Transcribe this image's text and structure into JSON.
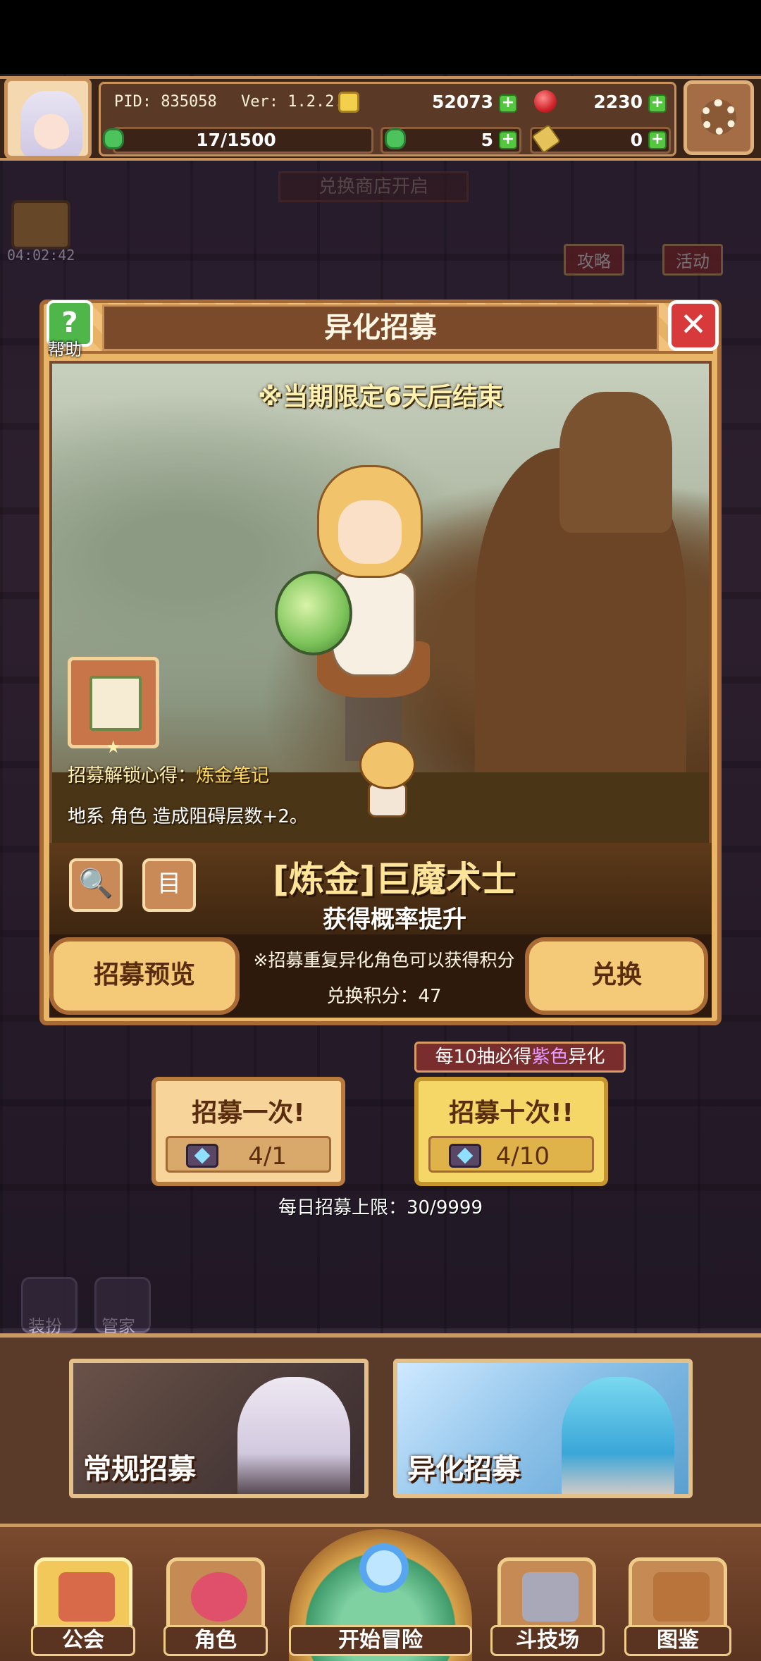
{
  "hud": {
    "pid": "PID: 835058",
    "version": "Ver: 1.2.2.5",
    "stamina": "17/1500",
    "gold": "52073",
    "ruby": "2230",
    "clover": "5",
    "keys": "0",
    "plus": "+"
  },
  "side": {
    "timer": "04:02:42",
    "strategy": "攻略",
    "activity": "活动",
    "exchange_banner": "兑换商店开启",
    "dress": "装扮",
    "steward": "管家"
  },
  "dialog": {
    "title": "异化招募",
    "help_label": "帮助",
    "help_glyph": "?",
    "close_glyph": "✕",
    "limit_notice": "※当期限定6天后结束",
    "unlock_label": "招募解锁心得：",
    "unlock_value": "炼金笔记",
    "effect": "地系 角色 造成阻碍层数+2。",
    "character_name": "[炼金]巨魔术士",
    "rate_up": "获得概率提升",
    "preview_button": "招募预览",
    "exchange_button": "兑换",
    "note": "※招募重复异化角色可以获得积分",
    "points": "兑换积分：47",
    "search_glyph": "🔍",
    "list_glyph": "目"
  },
  "draw": {
    "guarantee_prefix": "每10抽必得",
    "guarantee_highlight": "紫色",
    "guarantee_suffix": "异化",
    "once_title": "招募一次!",
    "once_cost": "4/1",
    "ten_title": "招募十次!!",
    "ten_cost": "4/10",
    "daily_limit": "每日招募上限：30/9999"
  },
  "tabs": {
    "normal": "常规招募",
    "alien": "异化招募"
  },
  "nav": {
    "guild": "公会",
    "character": "角色",
    "adventure": "开始冒险",
    "arena": "斗技场",
    "codex": "图鉴"
  },
  "colors": {
    "accent_gold": "#f4c977",
    "panel_brown": "#5a3a26",
    "name_yellow": "#ffe49a",
    "close_red": "#d8393b",
    "help_green": "#4fb64a"
  }
}
